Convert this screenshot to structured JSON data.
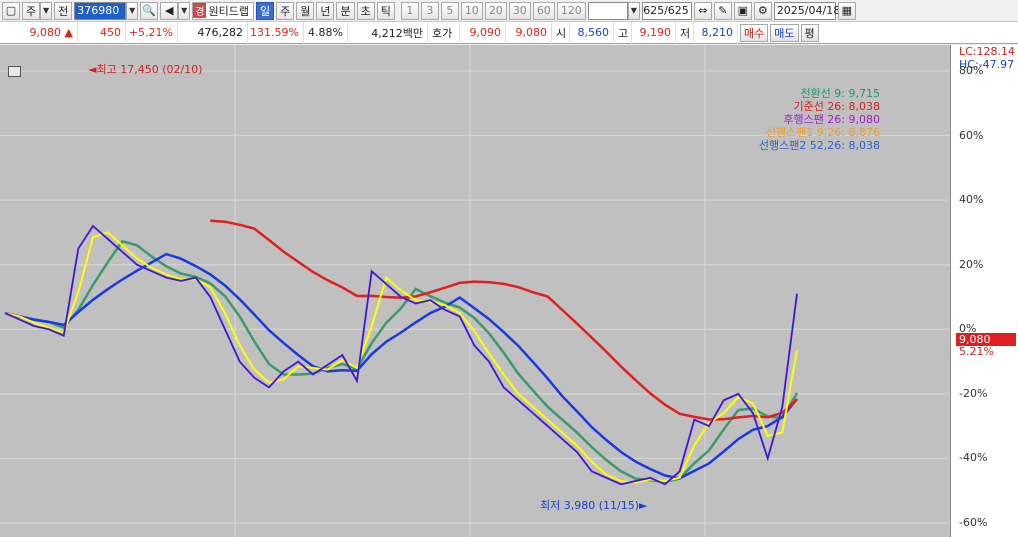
{
  "toolbar": {
    "window_icon": "window-icon",
    "period_label": "주",
    "mode_label": "전",
    "code": "376980",
    "badge": "경",
    "stock_name": "원티드랩",
    "period_buttons": [
      "일",
      "주",
      "월",
      "년",
      "분",
      "초",
      "틱"
    ],
    "active_period": "일",
    "interval_buttons": [
      "1",
      "3",
      "5",
      "10",
      "20",
      "30",
      "60",
      "120"
    ],
    "page_counter": "625/625",
    "date": "2025/04/18"
  },
  "infobar": {
    "price": "9,080",
    "change_arrow": "▲",
    "change": "450",
    "change_pct": "+5.21%",
    "volume": "476,282",
    "volume_ratio": "131.59%",
    "turnover": "4.88%",
    "amount": "4,212백만",
    "quote_label": "호가",
    "ask_quote": "9,090",
    "bid_quote": "9,080",
    "open_label": "시",
    "open": "8,560",
    "high_label": "고",
    "high": "9,190",
    "low_label": "저",
    "low": "8,210",
    "buy_button": "매수",
    "sell_button": "매도",
    "eval_button": "평"
  },
  "chart": {
    "lc_label": "LC:128.14",
    "hc_label": "HC:-47.97",
    "legend": [
      {
        "text": "전환선 9: 9,715",
        "color": "#1a9a6a"
      },
      {
        "text": "기준선 26: 8,038",
        "color": "#d42020"
      },
      {
        "text": "후행스팬 26: 9,080",
        "color": "#a020c0"
      },
      {
        "text": "선행스팬1 9,26: 8,876",
        "color": "#e8a030"
      },
      {
        "text": "선행스팬2 52,26: 8,038",
        "color": "#3060d0"
      }
    ],
    "high_annotation": "최고 17,450 (02/10)",
    "low_annotation": "최저 3,980 (11/15)",
    "current_price_tag": "9,080",
    "current_pct_tag": "5.21%",
    "colors": {
      "price_line": "#1a2acd",
      "price_spikes": "#e020e0",
      "tenkan": "#ffff00",
      "ma_green": "#3a9a6a",
      "ma_blue": "#1a3ae0",
      "ma_red": "#e02020",
      "cloud": "#ff9a00"
    }
  },
  "chart_data": {
    "type": "line",
    "title": "",
    "ylabel": "",
    "y_axis_ticks": [
      "80%",
      "60%",
      "40%",
      "20%",
      "0%",
      "-20%",
      "-40%",
      "-60%"
    ],
    "ylim": [
      -60,
      80
    ],
    "grid": true,
    "legend_position": "top-right",
    "series": [
      {
        "name": "",
        "values": [
          5,
          3,
          1,
          0,
          -2,
          25,
          32,
          28,
          24,
          20,
          18,
          16,
          15,
          16,
          10,
          0,
          -10,
          -15,
          -18,
          -13,
          -10,
          -14,
          -11,
          -8,
          -16,
          18,
          14,
          10,
          8,
          9,
          6,
          4,
          -5,
          -10,
          -18,
          -22,
          -26,
          -30,
          -34,
          -38,
          -44,
          -46,
          -48,
          -47,
          -46,
          -48,
          -44,
          -28,
          -30,
          -22,
          -20,
          -26,
          -40,
          -24,
          11
        ]
      }
    ]
  }
}
